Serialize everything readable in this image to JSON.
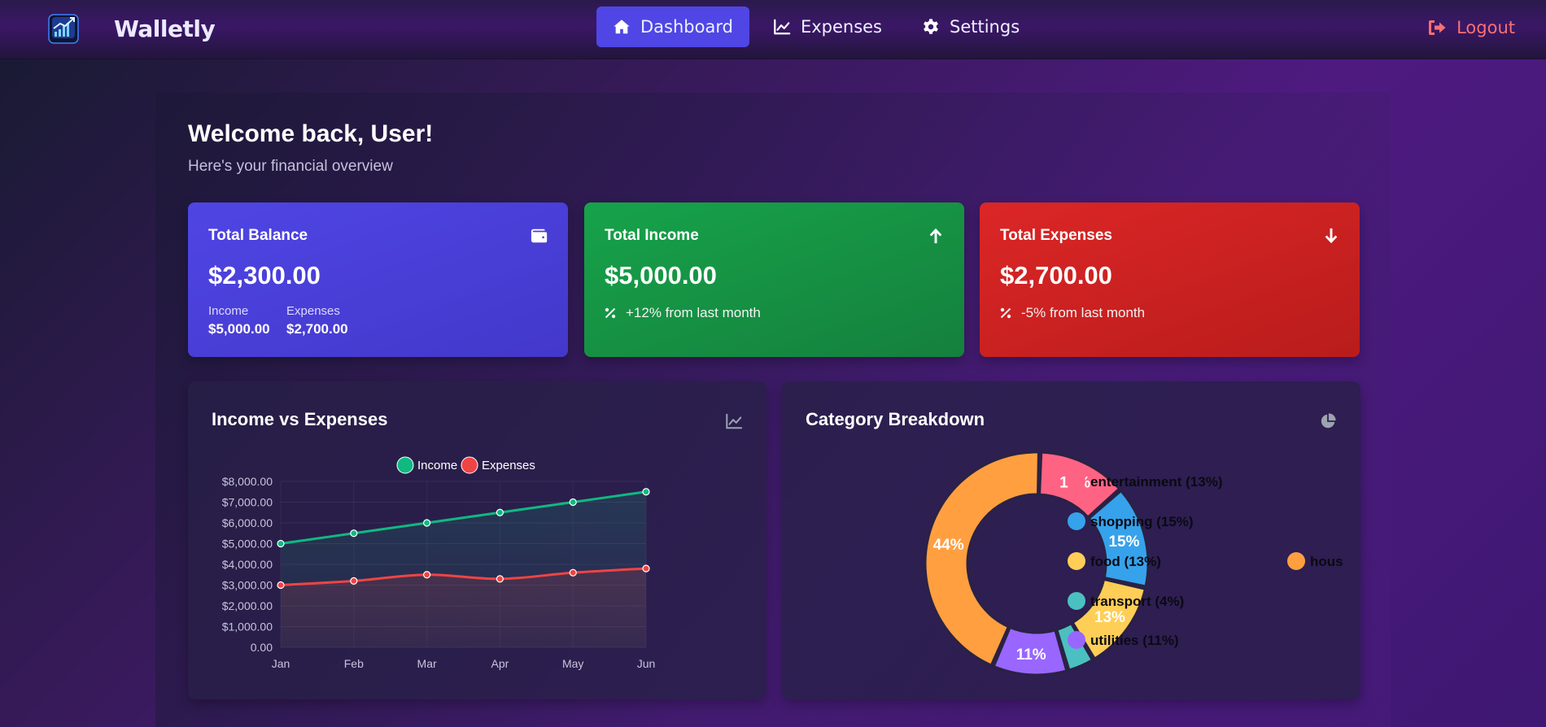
{
  "app": {
    "name": "Walletly"
  },
  "nav": {
    "links": [
      {
        "label": "Dashboard",
        "active": true,
        "icon": "home-icon"
      },
      {
        "label": "Expenses",
        "active": false,
        "icon": "chart-line-icon"
      },
      {
        "label": "Settings",
        "active": false,
        "icon": "gear-icon"
      }
    ],
    "logout_label": "Logout"
  },
  "header": {
    "welcome": "Welcome back, User!",
    "subtitle": "Here's your financial overview"
  },
  "cards": {
    "balance": {
      "title": "Total Balance",
      "amount": "$2,300.00",
      "income_label": "Income",
      "income_value": "$5,000.00",
      "expenses_label": "Expenses",
      "expenses_value": "$2,700.00",
      "icon": "wallet-icon"
    },
    "income": {
      "title": "Total Income",
      "amount": "$5,000.00",
      "trend": "+12% from last month",
      "icon": "arrow-up-icon"
    },
    "expense": {
      "title": "Total Expenses",
      "amount": "$2,700.00",
      "trend": "-5% from last month",
      "icon": "arrow-down-icon"
    }
  },
  "colors": {
    "accent": "#4f46e5",
    "income_green": "#10b981",
    "expense_red": "#ef4444",
    "logout": "#f87171"
  },
  "chart_data": [
    {
      "type": "line",
      "title": "Income vs Expenses",
      "categories": [
        "Jan",
        "Feb",
        "Mar",
        "Apr",
        "May",
        "Jun"
      ],
      "series": [
        {
          "name": "Income",
          "color": "#10b981",
          "values": [
            5000,
            5500,
            6000,
            6500,
            7000,
            7500
          ]
        },
        {
          "name": "Expenses",
          "color": "#ef4444",
          "values": [
            3000,
            3200,
            3500,
            3300,
            3600,
            3800
          ]
        }
      ],
      "y_ticks": [
        "$8,000.00",
        "$7,000.00",
        "$6,000.00",
        "$5,000.00",
        "$4,000.00",
        "$3,000.00",
        "$2,000.00",
        "$1,000.00",
        "0.00"
      ],
      "ylim": [
        0,
        8000
      ],
      "legend_position": "top",
      "filled": true
    },
    {
      "type": "pie",
      "title": "Category Breakdown",
      "donut": true,
      "slices": [
        {
          "name": "entertainment",
          "value": 13,
          "color": "#ff6384",
          "label": "13%",
          "legend": "entertainment (13%)"
        },
        {
          "name": "shopping",
          "value": 15,
          "color": "#36a2eb",
          "label": "15%",
          "legend": "shopping (15%)"
        },
        {
          "name": "food",
          "value": 13,
          "color": "#ffce56",
          "label": "13%",
          "legend": "food (13%)"
        },
        {
          "name": "transport",
          "value": 4,
          "color": "#4bc0c0",
          "label": "",
          "legend": "transport (4%)"
        },
        {
          "name": "utilities",
          "value": 11,
          "color": "#9966ff",
          "label": "11%",
          "legend": "utilities (11%)"
        },
        {
          "name": "housing",
          "value": 44,
          "color": "#ff9f40",
          "label": "44%",
          "legend": "hous"
        }
      ],
      "legend_position": "right"
    }
  ]
}
